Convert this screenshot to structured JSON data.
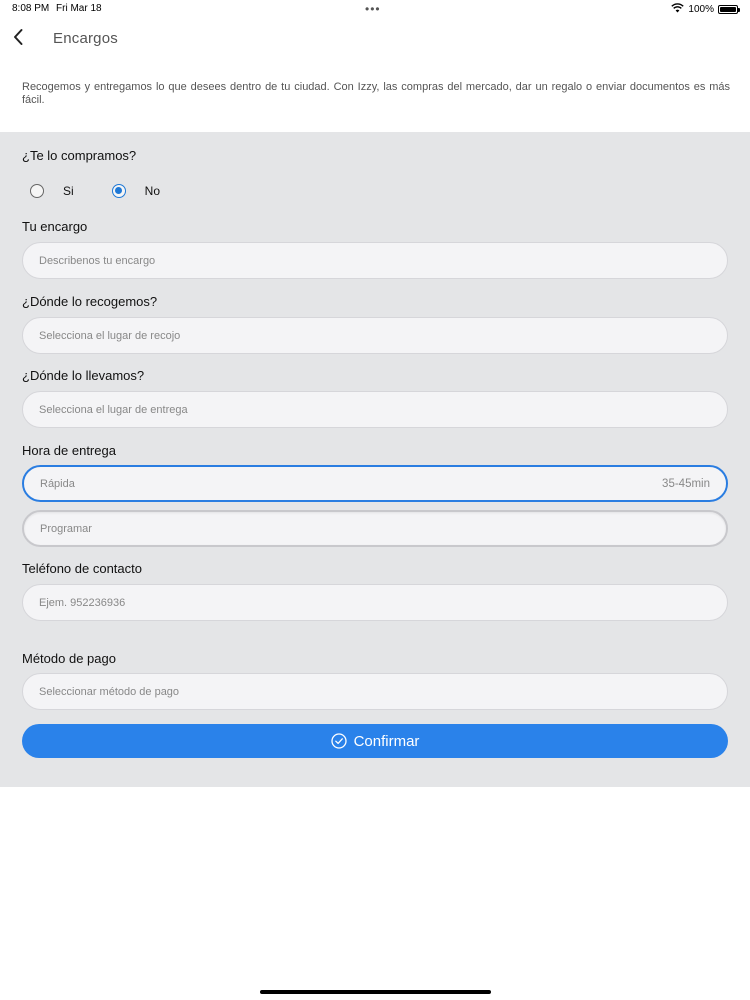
{
  "status_bar": {
    "time": "8:08 PM",
    "date": "Fri Mar 18",
    "battery": "100%",
    "battery_level": 1.0
  },
  "header": {
    "title": "Encargos",
    "back_icon": "chevron-left-icon"
  },
  "intro_text": "Recogemos y entregamos lo que desees dentro de tu ciudad. Con Izzy, las compras del mercado, dar un regalo o enviar documentos es más fácil.",
  "form": {
    "buy_question": {
      "label": "¿Te lo compramos?",
      "options": [
        "Si",
        "No"
      ],
      "selected": "No"
    },
    "order": {
      "label": "Tu encargo",
      "placeholder": "Describenos tu encargo"
    },
    "pickup": {
      "label": "¿Dónde lo recogemos?",
      "placeholder": "Selecciona el lugar de recojo"
    },
    "dropoff": {
      "label": "¿Dónde lo llevamos?",
      "placeholder": "Selecciona el lugar de entrega"
    },
    "delivery_time": {
      "label": "Hora de entrega",
      "fast": {
        "label": "Rápida",
        "eta": "35-45min"
      },
      "schedule": {
        "label": "Programar"
      },
      "selected": "Rápida"
    },
    "phone": {
      "label": "Teléfono de contacto",
      "placeholder": "Ejem. 952236936"
    },
    "payment": {
      "label": "Método de pago",
      "placeholder": "Seleccionar método de pago"
    },
    "confirm_label": "Confirmar"
  },
  "colors": {
    "accent": "#2a82ea",
    "panel_bg": "#e4e5e7"
  }
}
